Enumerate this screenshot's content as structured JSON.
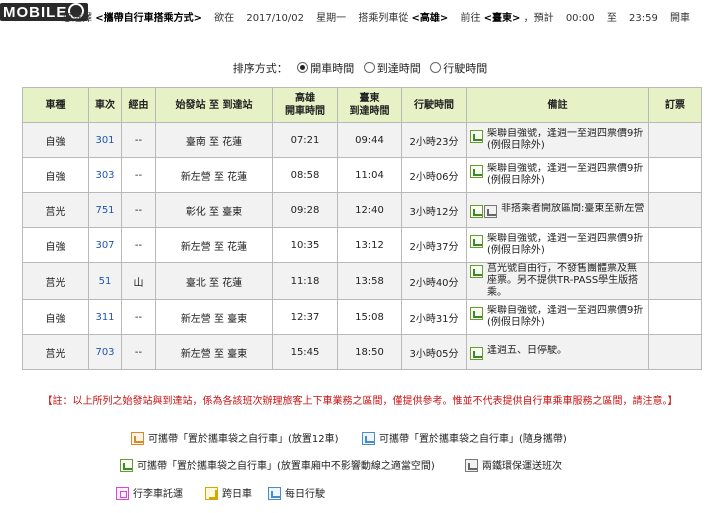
{
  "header": {
    "logo_text": "MOBILE",
    "prefix_text": "您選擇",
    "mode": "<攜帶自行車搭乘方式>",
    "want_label": "欲在",
    "date": "2017/10/02",
    "weekday": "星期一",
    "ride_label": "搭乘列車從",
    "from": "<高雄>",
    "to_label": "前往",
    "to": "<臺東>",
    "plan_label": "，預計",
    "time_from": "00:00",
    "until_label": "至",
    "time_to": "23:59",
    "depart_label": "開車"
  },
  "sort": {
    "label": "排序方式：",
    "options": [
      "開車時間",
      "到達時間",
      "行駛時間"
    ],
    "selected": "開車時間"
  },
  "table": {
    "headers": {
      "type": "車種",
      "no": "車次",
      "via": "經由",
      "route": "始發站 至 到達站",
      "dep_l1": "高雄",
      "dep_l2": "開車時間",
      "arr_l1": "臺東",
      "arr_l2": "到達時間",
      "dur": "行駛時間",
      "note": "備註",
      "ticket": "訂票"
    },
    "rows": [
      {
        "type": "自強",
        "no": "301",
        "via": "--",
        "route": "臺南 至 花蓮",
        "dep": "07:21",
        "arr": "09:44",
        "dur": "2小時23分",
        "icons": [
          "green"
        ],
        "note": "柴聯自強號，逢週一至週四票價9折(例假日除外)"
      },
      {
        "type": "自強",
        "no": "303",
        "via": "--",
        "route": "新左營 至 花蓮",
        "dep": "08:58",
        "arr": "11:04",
        "dur": "2小時06分",
        "icons": [
          "green"
        ],
        "note": "柴聯自強號，逢週一至週四票價9折(例假日除外)"
      },
      {
        "type": "莒光",
        "no": "751",
        "via": "--",
        "route": "彰化 至 臺東",
        "dep": "09:28",
        "arr": "12:40",
        "dur": "3小時12分",
        "icons": [
          "green",
          "gray"
        ],
        "note": "非搭乘者開放區間:臺東至新左營"
      },
      {
        "type": "自強",
        "no": "307",
        "via": "--",
        "route": "新左營 至 花蓮",
        "dep": "10:35",
        "arr": "13:12",
        "dur": "2小時37分",
        "icons": [
          "green"
        ],
        "note": "柴聯自強號，逢週一至週四票價9折(例假日除外)"
      },
      {
        "type": "莒光",
        "no": "51",
        "via": "山",
        "route": "臺北 至 花蓮",
        "dep": "11:18",
        "arr": "13:58",
        "dur": "2小時40分",
        "icons": [
          "green"
        ],
        "note": "莒光號自由行，不發售團體票及無座票。另不提供TR-PASS學生版搭乘。"
      },
      {
        "type": "自強",
        "no": "311",
        "via": "--",
        "route": "新左營 至 臺東",
        "dep": "12:37",
        "arr": "15:08",
        "dur": "2小時31分",
        "icons": [
          "green"
        ],
        "note": "柴聯自強號，逢週一至週四票價9折(例假日除外)"
      },
      {
        "type": "莒光",
        "no": "703",
        "via": "--",
        "route": "新左營 至 臺東",
        "dep": "15:45",
        "arr": "18:50",
        "dur": "3小時05分",
        "icons": [
          "green"
        ],
        "note": "逢週五、日停駛。"
      }
    ]
  },
  "footer_note": "【註：以上所列之始發站與到達站，係為各該班次辦理旅客上下車業務之區間，僅提供參考。惟並不代表提供自行車乘車服務之區間，請注意。】",
  "legend": {
    "bag12": "可攜帶「置於攜車袋之自行車」(放置12車)",
    "bag_carry": "可攜帶「置於攜車袋之自行車」(隨身攜帶)",
    "bag_area": "可攜帶「置於攜車袋之自行車」(放置車廂中不影響動線之適當空間)",
    "eco": "兩鐵環保運送班次",
    "luggage": "行李車託運",
    "crossday": "跨日車",
    "daily": "每日行駛"
  },
  "colors": {
    "header_bg": "#e6f2c6",
    "train_no": "#1f55b3",
    "footer_note": "#cc1111",
    "grid": "#b9b9b9"
  },
  "icons": {
    "green": "bike-bag-area-icon",
    "gray": "eco-train-icon",
    "orange": "bike-bag-12-icon",
    "blue": "bike-bag-carry-icon",
    "pink": "luggage-icon",
    "yellow": "crossday-icon",
    "daily": "daily-icon"
  }
}
